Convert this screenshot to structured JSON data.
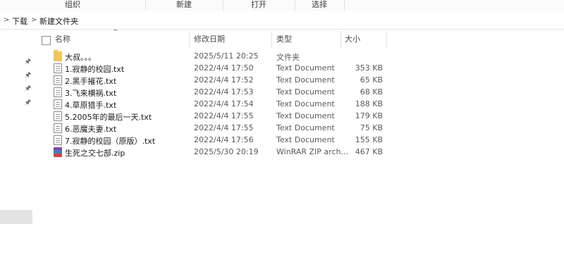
{
  "ribbon": {
    "groups": [
      "组织",
      "新建",
      "打开",
      "选择"
    ]
  },
  "address": {
    "crumbs": [
      "下载",
      "新建文件夹"
    ]
  },
  "columns": {
    "name": "名称",
    "date": "修改日期",
    "type": "类型",
    "size": "大小"
  },
  "files": [
    {
      "name": "大叔。。。",
      "date": "2025/5/11 20:25",
      "type": "文件夹",
      "size": "",
      "icon": "folder-icon"
    },
    {
      "name": "1.寂静的校园.txt",
      "date": "2022/4/4 17:50",
      "type": "Text Document",
      "size": "353 KB",
      "icon": "text-file-icon"
    },
    {
      "name": "2.黑手摧花.txt",
      "date": "2022/4/4 17:52",
      "type": "Text Document",
      "size": "65 KB",
      "icon": "text-file-icon"
    },
    {
      "name": "3.飞来横祸.txt",
      "date": "2022/4/4 17:53",
      "type": "Text Document",
      "size": "68 KB",
      "icon": "text-file-icon"
    },
    {
      "name": "4.草原猎手.txt",
      "date": "2022/4/4 17:54",
      "type": "Text Document",
      "size": "188 KB",
      "icon": "text-file-icon"
    },
    {
      "name": "5.2005年的最后一天.txt",
      "date": "2022/4/4 17:55",
      "type": "Text Document",
      "size": "179 KB",
      "icon": "text-file-icon"
    },
    {
      "name": "6.恶魔夫妻.txt",
      "date": "2022/4/4 17:55",
      "type": "Text Document",
      "size": "75 KB",
      "icon": "text-file-icon"
    },
    {
      "name": "7.寂静的校园（原版）.txt",
      "date": "2022/4/4 17:56",
      "type": "Text Document",
      "size": "155 KB",
      "icon": "text-file-icon"
    },
    {
      "name": "生死之交七部.zip",
      "date": "2025/5/30 20:19",
      "type": "WinRAR ZIP arch...",
      "size": "467 KB",
      "icon": "winrar-zip-icon"
    }
  ]
}
